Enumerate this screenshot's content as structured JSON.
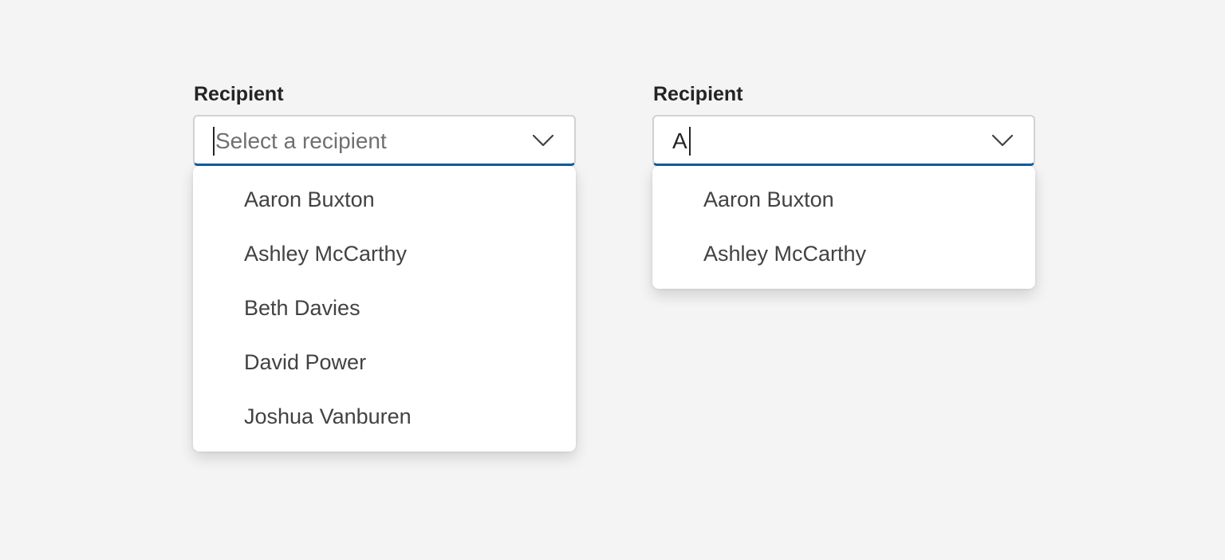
{
  "comboboxes": [
    {
      "label": "Recipient",
      "placeholder": "Select a recipient",
      "value": "",
      "options": [
        "Aaron Buxton",
        "Ashley McCarthy",
        "Beth Davies",
        "David Power",
        "Joshua Vanburen"
      ]
    },
    {
      "label": "Recipient",
      "placeholder": "",
      "value": "A",
      "options": [
        "Aaron Buxton",
        "Ashley McCarthy"
      ]
    }
  ],
  "icons": {
    "expand": "chevron-down-icon"
  },
  "colors": {
    "background": "#f4f4f4",
    "focus_underline": "#115ea3",
    "input_border": "#d1d1d1",
    "placeholder": "#707070",
    "option_text": "#424242"
  }
}
